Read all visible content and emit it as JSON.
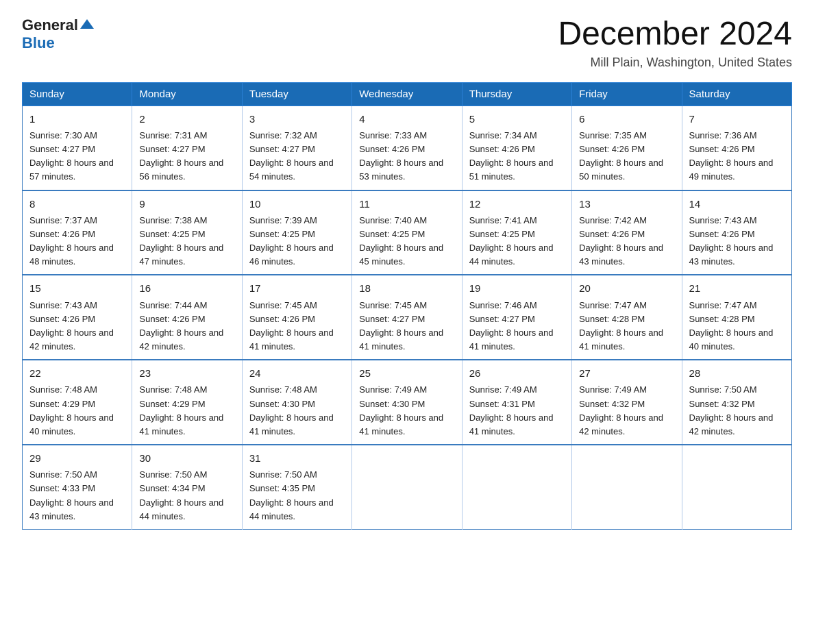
{
  "logo": {
    "general": "General",
    "blue": "Blue"
  },
  "header": {
    "month": "December 2024",
    "location": "Mill Plain, Washington, United States"
  },
  "weekdays": [
    "Sunday",
    "Monday",
    "Tuesday",
    "Wednesday",
    "Thursday",
    "Friday",
    "Saturday"
  ],
  "weeks": [
    [
      {
        "day": "1",
        "sunrise": "7:30 AM",
        "sunset": "4:27 PM",
        "daylight": "8 hours and 57 minutes."
      },
      {
        "day": "2",
        "sunrise": "7:31 AM",
        "sunset": "4:27 PM",
        "daylight": "8 hours and 56 minutes."
      },
      {
        "day": "3",
        "sunrise": "7:32 AM",
        "sunset": "4:27 PM",
        "daylight": "8 hours and 54 minutes."
      },
      {
        "day": "4",
        "sunrise": "7:33 AM",
        "sunset": "4:26 PM",
        "daylight": "8 hours and 53 minutes."
      },
      {
        "day": "5",
        "sunrise": "7:34 AM",
        "sunset": "4:26 PM",
        "daylight": "8 hours and 51 minutes."
      },
      {
        "day": "6",
        "sunrise": "7:35 AM",
        "sunset": "4:26 PM",
        "daylight": "8 hours and 50 minutes."
      },
      {
        "day": "7",
        "sunrise": "7:36 AM",
        "sunset": "4:26 PM",
        "daylight": "8 hours and 49 minutes."
      }
    ],
    [
      {
        "day": "8",
        "sunrise": "7:37 AM",
        "sunset": "4:26 PM",
        "daylight": "8 hours and 48 minutes."
      },
      {
        "day": "9",
        "sunrise": "7:38 AM",
        "sunset": "4:25 PM",
        "daylight": "8 hours and 47 minutes."
      },
      {
        "day": "10",
        "sunrise": "7:39 AM",
        "sunset": "4:25 PM",
        "daylight": "8 hours and 46 minutes."
      },
      {
        "day": "11",
        "sunrise": "7:40 AM",
        "sunset": "4:25 PM",
        "daylight": "8 hours and 45 minutes."
      },
      {
        "day": "12",
        "sunrise": "7:41 AM",
        "sunset": "4:25 PM",
        "daylight": "8 hours and 44 minutes."
      },
      {
        "day": "13",
        "sunrise": "7:42 AM",
        "sunset": "4:26 PM",
        "daylight": "8 hours and 43 minutes."
      },
      {
        "day": "14",
        "sunrise": "7:43 AM",
        "sunset": "4:26 PM",
        "daylight": "8 hours and 43 minutes."
      }
    ],
    [
      {
        "day": "15",
        "sunrise": "7:43 AM",
        "sunset": "4:26 PM",
        "daylight": "8 hours and 42 minutes."
      },
      {
        "day": "16",
        "sunrise": "7:44 AM",
        "sunset": "4:26 PM",
        "daylight": "8 hours and 42 minutes."
      },
      {
        "day": "17",
        "sunrise": "7:45 AM",
        "sunset": "4:26 PM",
        "daylight": "8 hours and 41 minutes."
      },
      {
        "day": "18",
        "sunrise": "7:45 AM",
        "sunset": "4:27 PM",
        "daylight": "8 hours and 41 minutes."
      },
      {
        "day": "19",
        "sunrise": "7:46 AM",
        "sunset": "4:27 PM",
        "daylight": "8 hours and 41 minutes."
      },
      {
        "day": "20",
        "sunrise": "7:47 AM",
        "sunset": "4:28 PM",
        "daylight": "8 hours and 41 minutes."
      },
      {
        "day": "21",
        "sunrise": "7:47 AM",
        "sunset": "4:28 PM",
        "daylight": "8 hours and 40 minutes."
      }
    ],
    [
      {
        "day": "22",
        "sunrise": "7:48 AM",
        "sunset": "4:29 PM",
        "daylight": "8 hours and 40 minutes."
      },
      {
        "day": "23",
        "sunrise": "7:48 AM",
        "sunset": "4:29 PM",
        "daylight": "8 hours and 41 minutes."
      },
      {
        "day": "24",
        "sunrise": "7:48 AM",
        "sunset": "4:30 PM",
        "daylight": "8 hours and 41 minutes."
      },
      {
        "day": "25",
        "sunrise": "7:49 AM",
        "sunset": "4:30 PM",
        "daylight": "8 hours and 41 minutes."
      },
      {
        "day": "26",
        "sunrise": "7:49 AM",
        "sunset": "4:31 PM",
        "daylight": "8 hours and 41 minutes."
      },
      {
        "day": "27",
        "sunrise": "7:49 AM",
        "sunset": "4:32 PM",
        "daylight": "8 hours and 42 minutes."
      },
      {
        "day": "28",
        "sunrise": "7:50 AM",
        "sunset": "4:32 PM",
        "daylight": "8 hours and 42 minutes."
      }
    ],
    [
      {
        "day": "29",
        "sunrise": "7:50 AM",
        "sunset": "4:33 PM",
        "daylight": "8 hours and 43 minutes."
      },
      {
        "day": "30",
        "sunrise": "7:50 AM",
        "sunset": "4:34 PM",
        "daylight": "8 hours and 44 minutes."
      },
      {
        "day": "31",
        "sunrise": "7:50 AM",
        "sunset": "4:35 PM",
        "daylight": "8 hours and 44 minutes."
      },
      null,
      null,
      null,
      null
    ]
  ],
  "labels": {
    "sunrise": "Sunrise:",
    "sunset": "Sunset:",
    "daylight": "Daylight:"
  }
}
